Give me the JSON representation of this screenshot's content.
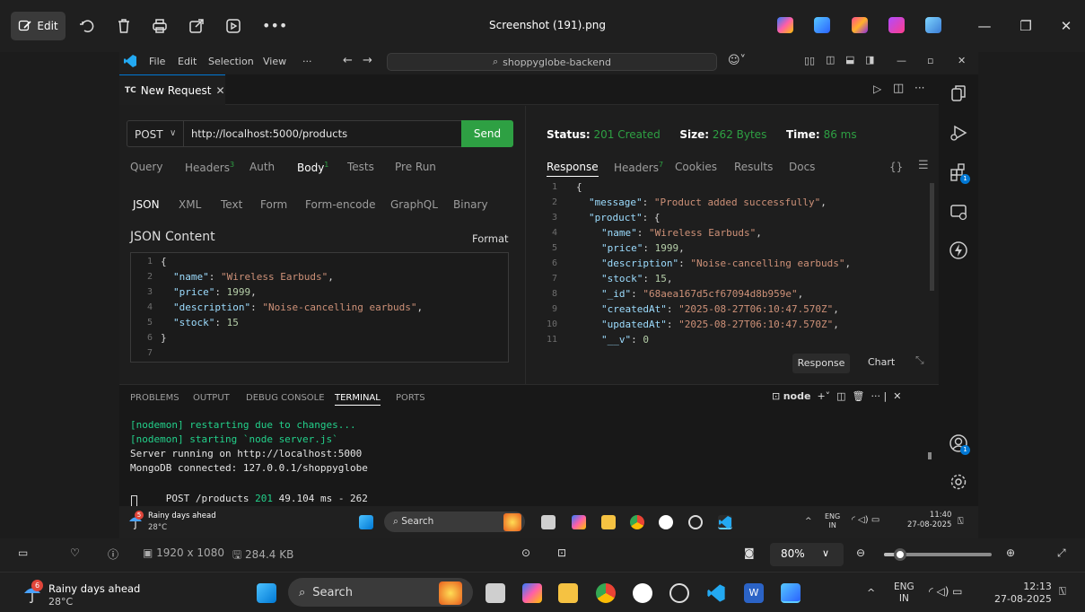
{
  "photos": {
    "edit_label": "Edit",
    "title": "Screenshot (191).png",
    "dimensions": "1920 x 1080",
    "filesize": "284.4 KB",
    "zoom": "80%",
    "zoom_level": 0.15
  },
  "vscode": {
    "menu": [
      "File",
      "Edit",
      "Selection",
      "View",
      "···"
    ],
    "search": "shoppyglobe-backend",
    "tab": {
      "logo": "TC",
      "label": "New Request"
    }
  },
  "request": {
    "method": "POST",
    "url": "http://localhost:5000/products",
    "send_label": "Send",
    "tabs": [
      {
        "label": "Query",
        "count": ""
      },
      {
        "label": "Headers",
        "count": "3"
      },
      {
        "label": "Auth",
        "count": ""
      },
      {
        "label": "Body",
        "count": "1"
      },
      {
        "label": "Tests",
        "count": ""
      },
      {
        "label": "Pre Run",
        "count": ""
      }
    ],
    "body_tabs": [
      "JSON",
      "XML",
      "Text",
      "Form",
      "Form-encode",
      "GraphQL",
      "Binary"
    ],
    "json_label": "JSON Content",
    "format_label": "Format",
    "code": [
      {
        "n": "1",
        "t": "{"
      },
      {
        "n": "2",
        "k": "\"name\"",
        "v": "\"Wireless Earbuds\"",
        "vt": "s",
        "tail": ","
      },
      {
        "n": "3",
        "k": "\"price\"",
        "v": "1999",
        "vt": "n",
        "tail": ","
      },
      {
        "n": "4",
        "k": "\"description\"",
        "v": "\"Noise-cancelling earbuds\"",
        "vt": "s",
        "tail": ","
      },
      {
        "n": "5",
        "k": "\"stock\"",
        "v": "15",
        "vt": "n",
        "tail": ""
      },
      {
        "n": "6",
        "t": "}"
      },
      {
        "n": "7",
        "t": ""
      }
    ]
  },
  "response": {
    "status_label": "Status:",
    "status_value": "201 Created",
    "size_label": "Size:",
    "size_value": "262 Bytes",
    "time_label": "Time:",
    "time_value": "86 ms",
    "tabs": [
      {
        "label": "Response",
        "count": ""
      },
      {
        "label": "Headers",
        "count": "7"
      },
      {
        "label": "Cookies",
        "count": ""
      },
      {
        "label": "Results",
        "count": ""
      },
      {
        "label": "Docs",
        "count": ""
      }
    ],
    "braces": "{}",
    "code": [
      {
        "n": "1",
        "ind": 0,
        "t": "{"
      },
      {
        "n": "2",
        "ind": 1,
        "k": "\"message\"",
        "v": "\"Product added successfully\"",
        "vt": "s",
        "tail": ","
      },
      {
        "n": "3",
        "ind": 1,
        "k": "\"product\"",
        "v": "{",
        "vt": "p",
        "tail": ""
      },
      {
        "n": "4",
        "ind": 2,
        "k": "\"name\"",
        "v": "\"Wireless Earbuds\"",
        "vt": "s",
        "tail": ","
      },
      {
        "n": "5",
        "ind": 2,
        "k": "\"price\"",
        "v": "1999",
        "vt": "n",
        "tail": ","
      },
      {
        "n": "6",
        "ind": 2,
        "k": "\"description\"",
        "v": "\"Noise-cancelling earbuds\"",
        "vt": "s",
        "tail": ","
      },
      {
        "n": "7",
        "ind": 2,
        "k": "\"stock\"",
        "v": "15",
        "vt": "n",
        "tail": ","
      },
      {
        "n": "8",
        "ind": 2,
        "k": "\"_id\"",
        "v": "\"68aea167d5cf67094d8b959e\"",
        "vt": "s",
        "tail": ","
      },
      {
        "n": "9",
        "ind": 2,
        "k": "\"createdAt\"",
        "v": "\"2025-08-27T06:10:47.570Z\"",
        "vt": "s",
        "tail": ","
      },
      {
        "n": "10",
        "ind": 2,
        "k": "\"updatedAt\"",
        "v": "\"2025-08-27T06:10:47.570Z\"",
        "vt": "s",
        "tail": ","
      },
      {
        "n": "11",
        "ind": 2,
        "k": "\"__v\"",
        "v": "0",
        "vt": "n",
        "tail": ""
      }
    ],
    "bottom_response": "Response",
    "bottom_chart": "Chart"
  },
  "terminal": {
    "tabs": [
      "PROBLEMS",
      "OUTPUT",
      "DEBUG CONSOLE",
      "TERMINAL",
      "PORTS"
    ],
    "shell": "node",
    "lines": [
      {
        "text": "[nodemon] restarting due to changes...",
        "color": "tg"
      },
      {
        "text": "[nodemon] starting `node server.js`",
        "color": "tg"
      },
      {
        "text": "Server running on http://localhost:5000",
        "color": "tw"
      },
      {
        "text": "MongoDB connected: 127.0.0.1/shoppyglobe",
        "color": "tw"
      }
    ],
    "post_pre": "POST /products ",
    "post_code": "201",
    "post_post": " 49.104 ms - 262"
  },
  "inner_taskbar": {
    "weather_badge": "5",
    "weather_title": "Rainy days ahead",
    "weather_temp": "28°C",
    "search": "Search",
    "lang_top": "ENG",
    "lang_bottom": "IN",
    "time": "11:40",
    "date": "27-08-2025"
  },
  "taskbar": {
    "weather_badge": "6",
    "weather_title": "Rainy days ahead",
    "weather_temp": "28°C",
    "search": "Search",
    "lang_top": "ENG",
    "lang_bottom": "IN",
    "time": "12:13",
    "date": "27-08-2025"
  },
  "colors": {
    "accent": "#0078d4",
    "success": "#2ea043",
    "json_key": "#9cdcfe",
    "json_string": "#ce9178",
    "json_number": "#b5cea8"
  }
}
